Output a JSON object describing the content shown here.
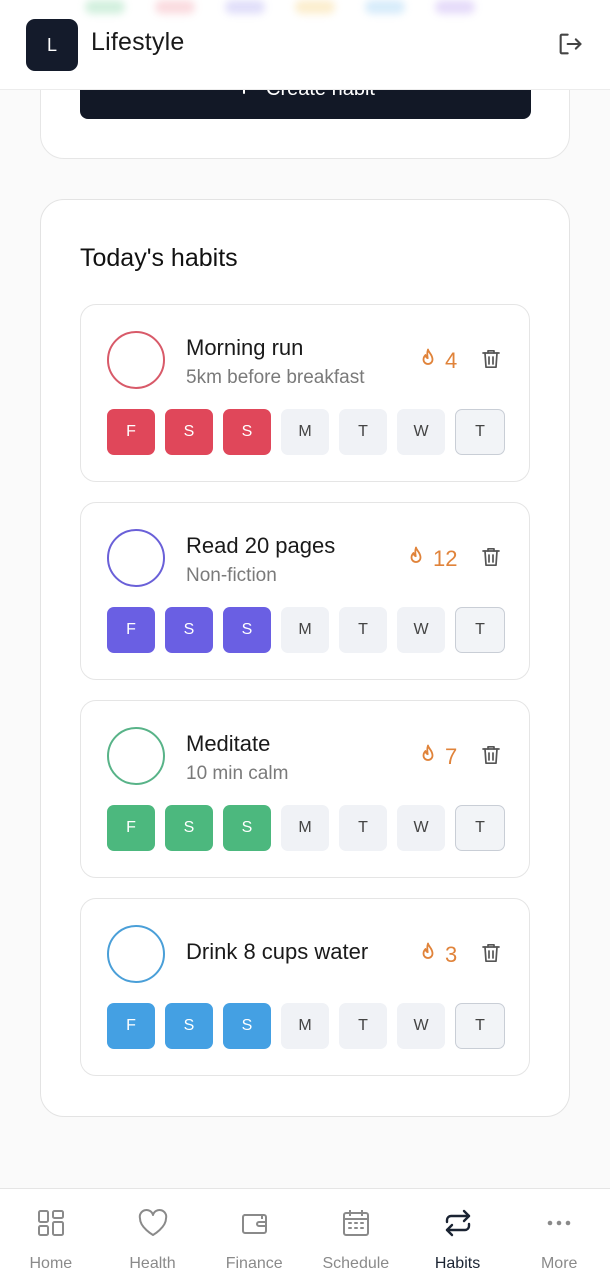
{
  "header": {
    "logo_letter": "L",
    "title": "Lifestyle"
  },
  "create_button": {
    "label": "Create habit"
  },
  "section": {
    "title": "Today's habits"
  },
  "day_labels": [
    "F",
    "S",
    "S",
    "M",
    "T",
    "W",
    "T"
  ],
  "habits": [
    {
      "name": "Morning run",
      "description": "5km before breakfast",
      "streak": "4",
      "color": "#e0475a",
      "ring": "#d85a69",
      "done_days": 3
    },
    {
      "name": "Read 20 pages",
      "description": "Non-fiction",
      "streak": "12",
      "color": "#6a5fe3",
      "ring": "#6a60d8",
      "done_days": 3
    },
    {
      "name": "Meditate",
      "description": "10 min calm",
      "streak": "7",
      "color": "#4cb87e",
      "ring": "#58b388",
      "done_days": 3
    },
    {
      "name": "Drink 8 cups water",
      "description": "",
      "streak": "3",
      "color": "#44a0e3",
      "ring": "#4a9fd8",
      "done_days": 3
    }
  ],
  "nav": [
    {
      "label": "Home",
      "icon": "grid-icon",
      "active": false
    },
    {
      "label": "Health",
      "icon": "heart-icon",
      "active": false
    },
    {
      "label": "Finance",
      "icon": "wallet-icon",
      "active": false
    },
    {
      "label": "Schedule",
      "icon": "calendar-icon",
      "active": false
    },
    {
      "label": "Habits",
      "icon": "repeat-icon",
      "active": true
    },
    {
      "label": "More",
      "icon": "more-icon",
      "active": false
    }
  ]
}
